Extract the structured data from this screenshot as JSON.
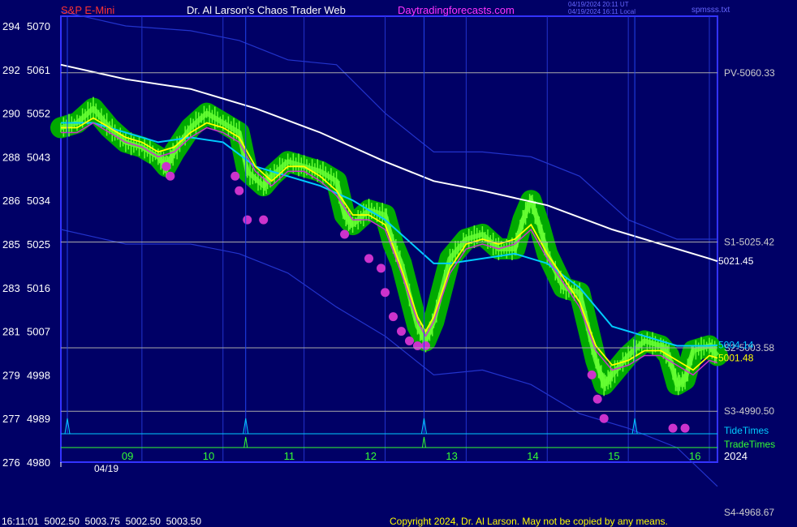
{
  "header": {
    "product": "S&P E-Mini",
    "site": "Dr. Al Larson's Chaos Trader Web",
    "url": "Daytradingforecasts.com",
    "stamp1": "04/19/2024 20:11 UT",
    "stamp2": "04/19/2024 16:11 Local",
    "file": "spmsss.txt"
  },
  "footer": {
    "quote": "16:11:01  5002.50  5003.75  5002.50  5003.50",
    "copyright": "Copyright 2024, Dr. Al Larson. May not be copied by any means."
  },
  "colors": {
    "background": "#000066",
    "frame": "#3333ff",
    "price": "#66ff33",
    "glow": "#00aa00",
    "fast_ma": "#ffff00",
    "slow_ma": "#00ccff",
    "long_ma": "#ffffff",
    "band": "#2233cc",
    "pink": "#cc33cc",
    "red": "#ff3333",
    "magenta": "#ff33ff"
  },
  "chart_data": {
    "type": "line",
    "title": "S&P E-Mini",
    "ylim": [
      4980,
      5072
    ],
    "y_ticks_price": [
      5070,
      5061,
      5052,
      5043,
      5034,
      5025,
      5016,
      5007,
      4998,
      4989,
      4980
    ],
    "y_ticks_left": [
      "294",
      "292",
      "290",
      "288",
      "286",
      "285",
      "283",
      "281",
      "279",
      "277",
      "276"
    ],
    "x_ticks": [
      "09",
      "10",
      "11",
      "12",
      "13",
      "14",
      "15",
      "16"
    ],
    "x_ticks_hour": [
      9,
      10,
      11,
      12,
      13,
      14,
      15,
      16
    ],
    "x_range": [
      8.0,
      16.1
    ],
    "date_label": "04/19",
    "year_label": "2024",
    "levels": [
      {
        "label": "PV-5060.33",
        "value": 5060.33
      },
      {
        "label": "S1-5025.42",
        "value": 5025.42
      },
      {
        "label": "S2-5003.58",
        "value": 5003.58
      },
      {
        "label": "S3-4990.50",
        "value": 4990.5
      },
      {
        "label": "S4-4968.67",
        "value": 4968.67
      }
    ],
    "value_labels": [
      {
        "text": "5021.45",
        "value": 5021.45,
        "series": "long"
      },
      {
        "text": "5004.14",
        "value": 5004.14,
        "series": "slow"
      },
      {
        "text": "5001.48",
        "value": 5001.48,
        "series": "fast"
      }
    ],
    "timing_lines": [
      {
        "name": "TideTimes",
        "times": [
          8.08,
          10.28,
          12.48,
          15.08
        ]
      },
      {
        "name": "TradeTimes",
        "times": [
          10.28,
          12.48
        ]
      }
    ],
    "series": [
      {
        "name": "price",
        "x": [
          8.0,
          8.2,
          8.4,
          8.6,
          8.8,
          9.0,
          9.2,
          9.3,
          9.4,
          9.6,
          9.8,
          10.0,
          10.2,
          10.3,
          10.5,
          10.6,
          10.8,
          11.0,
          11.2,
          11.4,
          11.5,
          11.6,
          11.8,
          12.0,
          12.1,
          12.2,
          12.4,
          12.5,
          12.6,
          12.8,
          13.0,
          13.2,
          13.4,
          13.6,
          13.7,
          13.8,
          13.9,
          14.0,
          14.2,
          14.4,
          14.5,
          14.6,
          14.7,
          14.8,
          15.0,
          15.2,
          15.4,
          15.5,
          15.6,
          15.7,
          15.8,
          16.0,
          16.1
        ],
        "y": [
          5049,
          5050,
          5053,
          5049,
          5046,
          5045,
          5043,
          5041,
          5044,
          5049,
          5052,
          5050,
          5048,
          5040,
          5037,
          5039,
          5042,
          5041,
          5040,
          5038,
          5031,
          5029,
          5032,
          5031,
          5025,
          5021,
          5008,
          5005,
          5009,
          5022,
          5026,
          5027,
          5024,
          5024,
          5030,
          5034,
          5029,
          5023,
          5016,
          5015,
          5008,
          5001,
          4996,
          4998,
          5002,
          5005,
          5004,
          5002,
          4996,
          4997,
          5003,
          5004,
          5002
        ]
      },
      {
        "name": "fast",
        "x": [
          8.0,
          8.2,
          8.4,
          8.6,
          8.8,
          9.0,
          9.2,
          9.4,
          9.6,
          9.8,
          10.0,
          10.2,
          10.4,
          10.6,
          10.8,
          11.0,
          11.2,
          11.4,
          11.6,
          11.8,
          12.0,
          12.2,
          12.4,
          12.5,
          12.6,
          12.8,
          13.0,
          13.2,
          13.4,
          13.6,
          13.8,
          14.0,
          14.2,
          14.4,
          14.6,
          14.8,
          15.0,
          15.2,
          15.4,
          15.6,
          15.8,
          16.0,
          16.1
        ],
        "y": [
          5049,
          5049,
          5051,
          5049,
          5047,
          5046,
          5044,
          5045,
          5048,
          5050,
          5049,
          5047,
          5041,
          5038,
          5041,
          5041,
          5039,
          5036,
          5031,
          5031,
          5029,
          5020,
          5010,
          5007,
          5010,
          5020,
          5025,
          5026,
          5025,
          5026,
          5029,
          5023,
          5018,
          5013,
          5004,
          5000,
          5001,
          5003,
          5003,
          5001,
          4999,
          5002,
          5001.48
        ]
      },
      {
        "name": "slow",
        "x": [
          8.0,
          8.4,
          8.8,
          9.2,
          9.6,
          10.0,
          10.4,
          10.8,
          11.2,
          11.6,
          12.0,
          12.4,
          12.6,
          12.8,
          13.2,
          13.6,
          14.0,
          14.4,
          14.8,
          15.2,
          15.6,
          16.0,
          16.1
        ],
        "y": [
          5050,
          5050,
          5048,
          5046,
          5047,
          5046,
          5041,
          5039,
          5037,
          5034,
          5030,
          5024,
          5021,
          5021,
          5022,
          5023,
          5021,
          5016,
          5008,
          5006,
          5004,
          5004,
          5004.14
        ]
      },
      {
        "name": "long",
        "x": [
          8.0,
          8.8,
          9.6,
          10.4,
          11.2,
          12.0,
          12.6,
          13.2,
          14.0,
          14.8,
          15.4,
          16.0,
          16.1
        ],
        "y": [
          5062,
          5059,
          5057,
          5053,
          5048,
          5042,
          5038,
          5036,
          5033,
          5028,
          5025,
          5022,
          5021.45
        ]
      },
      {
        "name": "upper_band",
        "x": [
          8.0,
          8.8,
          9.6,
          10.2,
          10.8,
          11.4,
          12.0,
          12.6,
          13.2,
          13.8,
          14.4,
          15.0,
          15.6,
          16.1
        ],
        "y": [
          5073,
          5070,
          5069,
          5067,
          5063,
          5062,
          5052,
          5044,
          5044,
          5043,
          5039,
          5030,
          5026,
          5026
        ]
      },
      {
        "name": "lower_band",
        "x": [
          8.0,
          8.8,
          9.6,
          10.2,
          10.8,
          11.4,
          12.0,
          12.6,
          13.2,
          13.8,
          14.4,
          15.0,
          15.6,
          16.1
        ],
        "y": [
          5028,
          5025,
          5025,
          5023,
          5019,
          5012,
          5006,
          4998,
          4999,
          4996,
          4990,
          4987,
          4983,
          4975
        ]
      }
    ],
    "pink_marks": {
      "x": [
        9.3,
        9.35,
        10.15,
        10.2,
        10.3,
        10.5,
        11.5,
        11.8,
        11.95,
        12.0,
        12.1,
        12.2,
        12.3,
        12.4,
        12.5,
        14.55,
        14.62,
        14.7,
        15.55,
        15.7
      ],
      "y": [
        5041,
        5039,
        5039,
        5036,
        5030,
        5030,
        5027,
        5022,
        5020,
        5015,
        5010,
        5007,
        5005,
        5004,
        5004,
        4998,
        4993,
        4989,
        4987,
        4987
      ]
    },
    "legend": [
      {
        "label": "TideTimes",
        "color": "#00ccff"
      },
      {
        "label": "TradeTimes",
        "color": "#33ff33"
      }
    ]
  }
}
